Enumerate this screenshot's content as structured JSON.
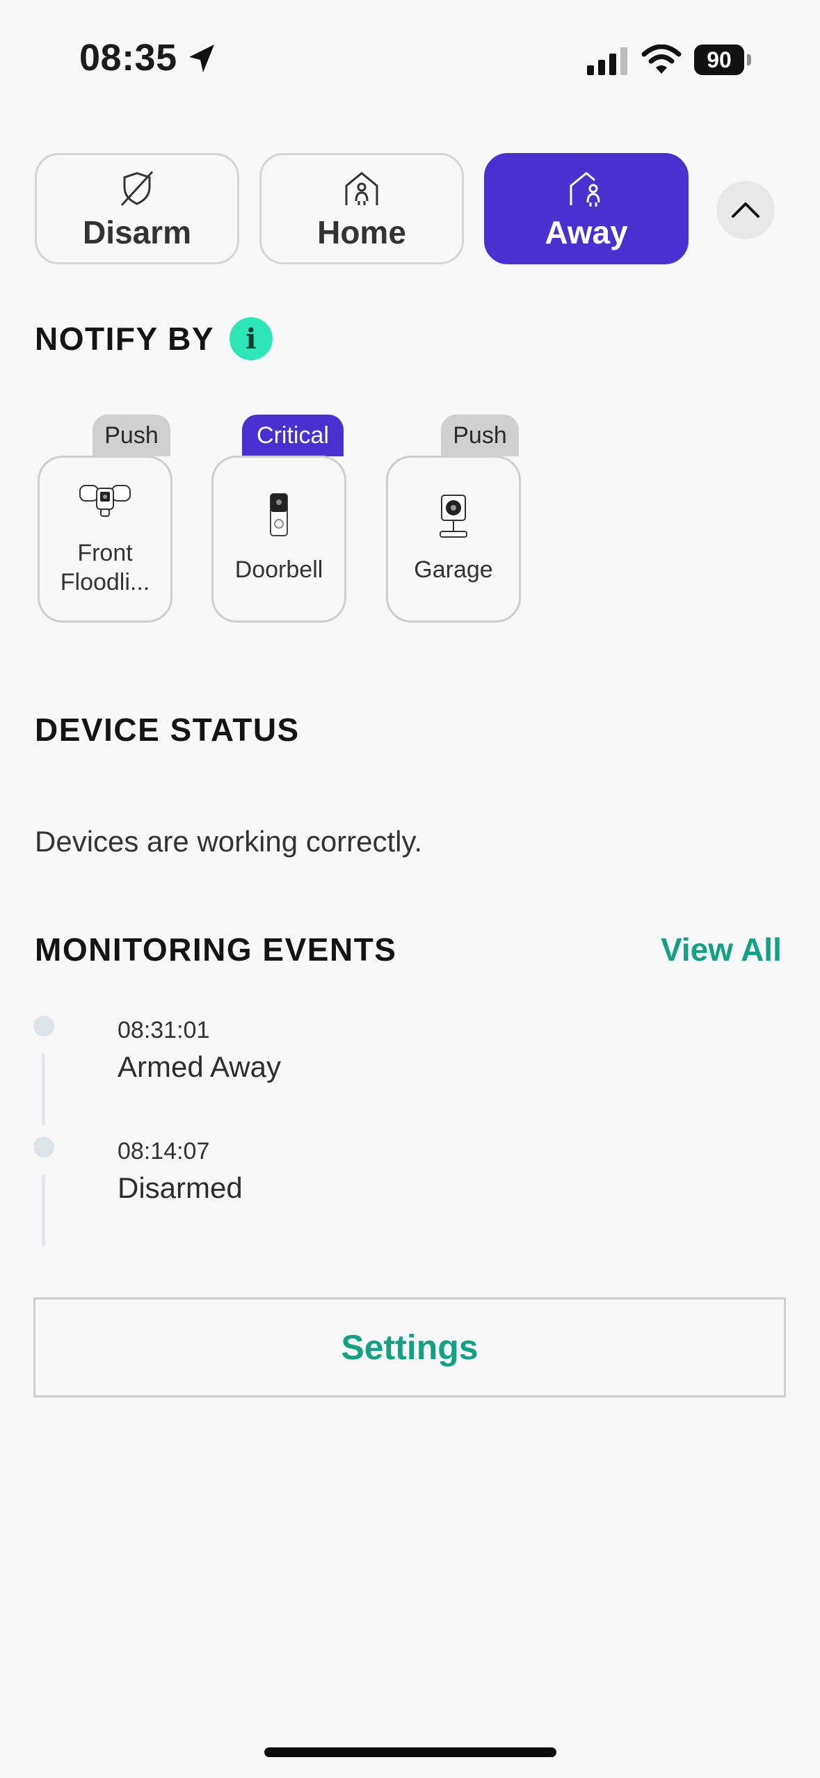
{
  "status_bar": {
    "time": "08:35",
    "battery": "90",
    "icons": [
      "location-arrow-icon",
      "cellular-signal-icon",
      "wifi-icon",
      "battery-icon"
    ]
  },
  "modes": [
    {
      "label": "Disarm",
      "icon": "shield-off-icon",
      "active": false
    },
    {
      "label": "Home",
      "icon": "house-person-icon",
      "active": false
    },
    {
      "label": "Away",
      "icon": "house-person-away-icon",
      "active": true
    }
  ],
  "notify": {
    "title": "NOTIFY BY",
    "info_icon": "i",
    "devices": [
      {
        "tag": "Push",
        "name_line1": "Front",
        "name_line2": "Floodli...",
        "icon": "floodlight-camera-icon"
      },
      {
        "tag": "Critical",
        "name": "Doorbell",
        "icon": "video-doorbell-icon"
      },
      {
        "tag": "Push",
        "name": "Garage",
        "icon": "indoor-camera-icon"
      }
    ]
  },
  "device_status": {
    "title": "DEVICE STATUS",
    "text": "Devices are working correctly."
  },
  "monitoring": {
    "title": "MONITORING EVENTS",
    "view_all": "View All",
    "events": [
      {
        "time": "08:31:01",
        "title": "Armed Away"
      },
      {
        "time": "08:14:07",
        "title": "Disarmed"
      }
    ]
  },
  "settings_label": "Settings",
  "colors": {
    "accent": "#4a2fd1",
    "link": "#12a283",
    "info": "#2ee6b5",
    "background": "#f8f8f8"
  }
}
